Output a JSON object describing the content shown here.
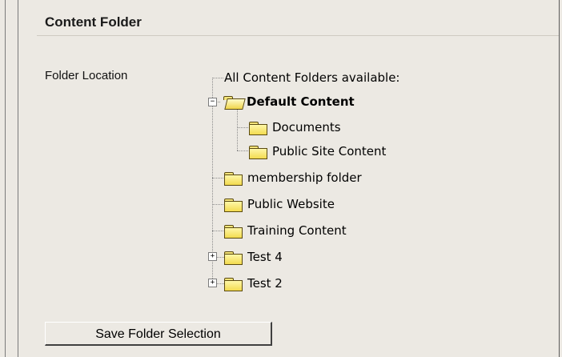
{
  "panel": {
    "title": "Content Folder",
    "folder_location_label": "Folder Location"
  },
  "tree": {
    "root_label": "All Content Folders available:",
    "items": [
      {
        "label": "Default Content",
        "expanded": true,
        "bold": true,
        "icon": "folder-open-icon"
      },
      {
        "label": "Documents",
        "icon": "folder-icon"
      },
      {
        "label": "Public Site Content",
        "icon": "folder-icon"
      },
      {
        "label": "membership folder",
        "icon": "folder-icon"
      },
      {
        "label": "Public Website",
        "icon": "folder-icon"
      },
      {
        "label": "Training Content",
        "icon": "folder-icon"
      },
      {
        "label": "Test 4",
        "expandable": true,
        "icon": "folder-icon"
      },
      {
        "label": "Test 2",
        "expandable": true,
        "icon": "folder-icon"
      }
    ]
  },
  "actions": {
    "save_label": "Save Folder Selection"
  }
}
